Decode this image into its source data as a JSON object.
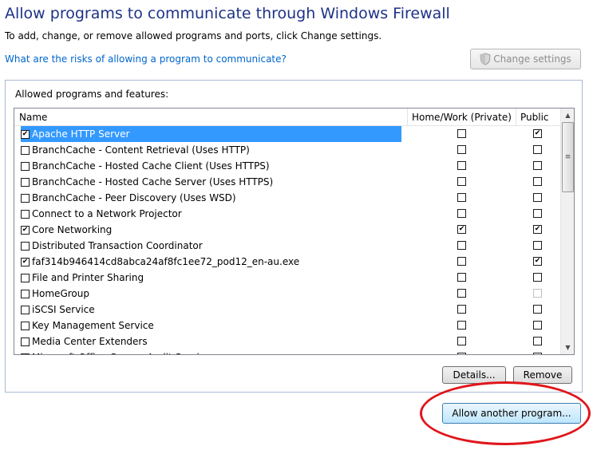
{
  "header": {
    "title": "Allow programs to communicate through Windows Firewall",
    "subtitle": "To add, change, or remove allowed programs and ports, click Change settings.",
    "risk_link": "What are the risks of allowing a program to communicate?",
    "change_settings_label": "Change settings"
  },
  "panel": {
    "label": "Allowed programs and features:",
    "columns": {
      "name": "Name",
      "home": "Home/Work (Private)",
      "public": "Public"
    },
    "rows": [
      {
        "name": "Apache HTTP Server",
        "enabled": true,
        "home": false,
        "public": true,
        "selected": true
      },
      {
        "name": "BranchCache - Content Retrieval (Uses HTTP)",
        "enabled": false,
        "home": false,
        "public": false
      },
      {
        "name": "BranchCache - Hosted Cache Client (Uses HTTPS)",
        "enabled": false,
        "home": false,
        "public": false
      },
      {
        "name": "BranchCache - Hosted Cache Server (Uses HTTPS)",
        "enabled": false,
        "home": false,
        "public": false
      },
      {
        "name": "BranchCache - Peer Discovery (Uses WSD)",
        "enabled": false,
        "home": false,
        "public": false
      },
      {
        "name": "Connect to a Network Projector",
        "enabled": false,
        "home": false,
        "public": false
      },
      {
        "name": "Core Networking",
        "enabled": true,
        "home": true,
        "public": true
      },
      {
        "name": "Distributed Transaction Coordinator",
        "enabled": false,
        "home": false,
        "public": false
      },
      {
        "name": "faf314b946414cd8abca24af8fc1ee72_pod12_en-au.exe",
        "enabled": true,
        "home": false,
        "public": true
      },
      {
        "name": "File and Printer Sharing",
        "enabled": false,
        "home": false,
        "public": false
      },
      {
        "name": "HomeGroup",
        "enabled": false,
        "home": false,
        "public": false,
        "public_disabled": true
      },
      {
        "name": "iSCSI Service",
        "enabled": false,
        "home": false,
        "public": false
      },
      {
        "name": "Key Management Service",
        "enabled": false,
        "home": false,
        "public": false
      },
      {
        "name": "Media Center Extenders",
        "enabled": false,
        "home": false,
        "public": false
      },
      {
        "name": "Microsoft Office Groove Audit Service",
        "enabled": false,
        "home": false,
        "public": false
      }
    ],
    "details_label": "Details...",
    "remove_label": "Remove"
  },
  "footer": {
    "allow_another_label": "Allow another program..."
  },
  "colors": {
    "title": "#1e3287",
    "link": "#0066cc",
    "selection": "#3399ff",
    "annotation": "#e0161b"
  }
}
